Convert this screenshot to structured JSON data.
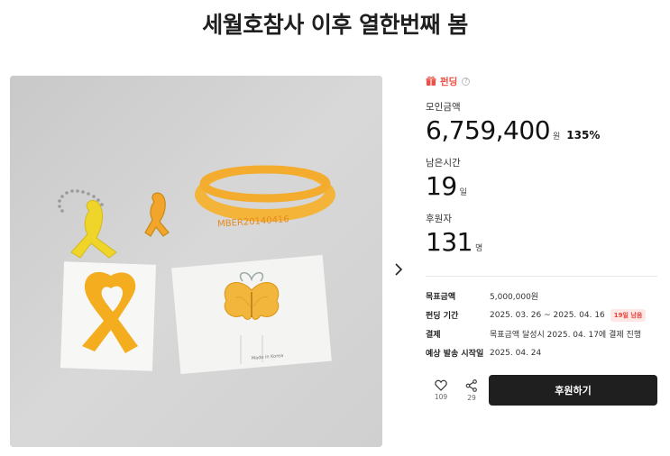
{
  "page": {
    "title": "세월호참사 이후 열한번째 봄"
  },
  "funding": {
    "tag_label": "펀딩",
    "info_icon": "info-icon",
    "gift_icon": "gift-icon",
    "raised_label": "모인금액",
    "raised_amount": "6,759,400",
    "raised_unit": "원",
    "raised_percent": "135%",
    "time_label": "남은시간",
    "time_value": "19",
    "time_unit": "일",
    "backers_label": "후원자",
    "backers_value": "131",
    "backers_unit": "명"
  },
  "details": {
    "goal_key": "목표금액",
    "goal_val": "5,000,000원",
    "period_key": "펀딩 기간",
    "period_val": "2025. 03. 26 ~ 2025. 04. 16",
    "period_badge": "19일 남음",
    "payment_key": "결제",
    "payment_val": "목표금액 달성시 2025. 04. 17에 결제 진행",
    "ship_key": "예상 발송 시작일",
    "ship_val": "2025. 04. 24"
  },
  "actions": {
    "like_count": "109",
    "share_count": "29",
    "back_label": "후원하기"
  },
  "photo": {
    "band_text": "MBER20140416",
    "card_text": "Made in Korea"
  },
  "colors": {
    "accent": "#f04e45",
    "button_bg": "#1f1f1f",
    "ribbon_yellow": "#f1d62b",
    "ribbon_orange": "#f4ad2c"
  }
}
